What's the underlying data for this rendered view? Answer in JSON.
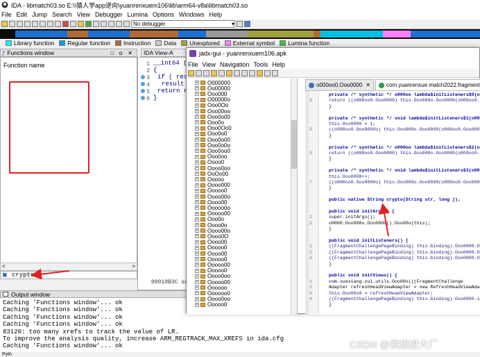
{
  "ida": {
    "title": "IDA - libmatch03.so E:\\\\猿人学app逆向\\yuanrenxuem106\\lib\\arm64-v8a\\libmatch03.so",
    "menu": [
      "File",
      "Edit",
      "Jump",
      "Search",
      "View",
      "Debugger",
      "Lumina",
      "Options",
      "Windows",
      "Help"
    ],
    "debugger_select": "No debugger",
    "legend": [
      {
        "label": "Library function",
        "color": "#00ffff"
      },
      {
        "label": "Regular function",
        "color": "#00a0e0"
      },
      {
        "label": "Instruction",
        "color": "#b06a3a"
      },
      {
        "label": "Data",
        "color": "#c8c8c8"
      },
      {
        "label": "Unexplored",
        "color": "#a0a040"
      },
      {
        "label": "External symbol",
        "color": "#ff80ff"
      },
      {
        "label": "Lumina function",
        "color": "#40c040"
      }
    ],
    "functions_window": {
      "title": "Functions window",
      "column": "Function name",
      "search_value": "crypto"
    },
    "ida_view": {
      "tab": "IDA View-A",
      "lines": [
        "__int64 (*",
        "{",
        "if ( res",
        "result",
        "return r",
        "}"
      ],
      "line_numbers": [
        "1",
        "2",
        "3",
        "4",
        "5",
        "6"
      ],
      "status": "00010B3C su"
    },
    "output": {
      "title": "Output window",
      "lines": [
        "Caching 'Functions window'... ok",
        "Caching 'Functions window'... ok",
        "Caching 'Functions window'... ok",
        "Caching 'Functions window'... ok",
        "83120: too many xrefs to track the value of LR.",
        "To improve the analysis quality, increase ARM_REGTRACK_MAX_XREFS in ida.cfg",
        "Caching 'Functions window'... ok"
      ],
      "bottom": "Pyth"
    }
  },
  "jadx": {
    "title": "jadx-gui - yuanrenxuem106.apk",
    "menu": [
      "File",
      "View",
      "Navigation",
      "Tools",
      "Help"
    ],
    "tree_items": [
      "O000000",
      "Oo00000",
      "Ooo000",
      "O00000o",
      "Ooo0Oo",
      "Ooo00oo",
      "Ooo0o00",
      "Ooo0o",
      "Ooo0Oo0",
      "Ooo0o0",
      "Ooo0o00",
      "Ooo0o0o",
      "Ooo0oo0",
      "Ooo0oo",
      "Oooo0",
      "Oooo0oo",
      "OoOo00",
      "Ooooo",
      "Oooo000",
      "Ooooo0",
      "Oooo00o",
      "Oooo00",
      "Ooooo0o",
      "Ooooo00",
      "Ooo0o",
      "Oooo0o",
      "Oooo00o",
      "Oooo0O",
      "Oooo00",
      "Ooooo0",
      "Oooo00",
      "Ooooo0",
      "Ooooo00",
      "Ooooo0",
      "Oooo0oo",
      "Ooooo00",
      "Oooooo",
      "Oooooo0",
      "Oooo0oo",
      "Ooooo0"
    ],
    "tabs": [
      {
        "label": "o000oo0.Ooo0000",
        "active": false
      },
      {
        "label": "com.yuanrenxue.match2022.fragment.",
        "active": true
      }
    ],
    "code_lines": [
      {
        "n": "",
        "t": "private /* synthetic */ o000oo lambda$initListeners$0(o000"
      },
      {
        "n": "3",
        "t": "    return ((o000oo0.Ooo0000) this.Ooo000o.Ooo0000(o000oo0."
      },
      {
        "n": "",
        "t": "}"
      },
      {
        "n": "",
        "t": ""
      },
      {
        "n": "",
        "t": "private /* synthetic */ void lambda$initListeners$1(o0000 o"
      },
      {
        "n": "",
        "t": "    this.Ooo0000 = 1;"
      },
      {
        "n": "3",
        "t": "    ((o000oo0.Ooo0000o) this.Ooo000o.Ooo0000(o000oo0.Ooo0000."
      },
      {
        "n": "",
        "t": "}"
      },
      {
        "n": "",
        "t": ""
      },
      {
        "n": "",
        "t": "private /* synthetic */ o000oo lambda$initListeners$2(o000"
      },
      {
        "n": "3",
        "t": "    return ((o000oo0.Ooo0000) this.Ooo000o.Ooo0000(o000oo0."
      },
      {
        "n": "",
        "t": "}"
      },
      {
        "n": "",
        "t": ""
      },
      {
        "n": "",
        "t": "private /* synthetic */ void lambda$initListeners$3(o0000 o"
      },
      {
        "n": "",
        "t": "    this.Ooo0000++;"
      },
      {
        "n": "7",
        "t": "    ((o000oo0.Ooo0000o) this.Ooo000o.Ooo0000(o000oo0.Ooo0000."
      },
      {
        "n": "",
        "t": "}"
      },
      {
        "n": "",
        "t": ""
      },
      {
        "n": "",
        "t": "public native String crypto(String str, long j);"
      },
      {
        "n": "",
        "t": ""
      },
      {
        "n": "",
        "t": "public void initArgs() {"
      },
      {
        "n": "1",
        "t": "    super.initArgs();"
      },
      {
        "n": "2",
        "t": "    o0000.Ooo000o.Ooo0000().Ooo00o(this);"
      },
      {
        "n": "",
        "t": "}"
      },
      {
        "n": "",
        "t": ""
      },
      {
        "n": "",
        "t": "public void initListeners() {"
      },
      {
        "n": "1",
        "t": "    ((FragmentChallengePageBinding) this.binding).Ooo0000.Oo"
      },
      {
        "n": "2",
        "t": "    ((FragmentChallengePageBinding) this.binding).Ooo0000.Oo"
      },
      {
        "n": "3",
        "t": "    ((FragmentChallengePageBinding) this.binding).Ooo0000.Oo"
      },
      {
        "n": "",
        "t": "}"
      },
      {
        "n": "",
        "t": ""
      },
      {
        "n": "",
        "t": "public void initViews() {"
      },
      {
        "n": "1",
        "t": "    com.xuexiang.xui.utils.Ooo00o(((FragmentChallenge"
      },
      {
        "n": "2",
        "t": "    Adapter refreshHeadViewAdapter = new RefreshHeadViewAdap"
      },
      {
        "n": "3",
        "t": "    this.Ooo00o0 = refreshHeadViewAdapter;"
      },
      {
        "n": "4",
        "t": "    ((FragmentChallengePageBinding) this.binding).Ooo0000.se"
      },
      {
        "n": "",
        "t": "}"
      }
    ]
  },
  "watermark": "CSDN @我想进大厂"
}
